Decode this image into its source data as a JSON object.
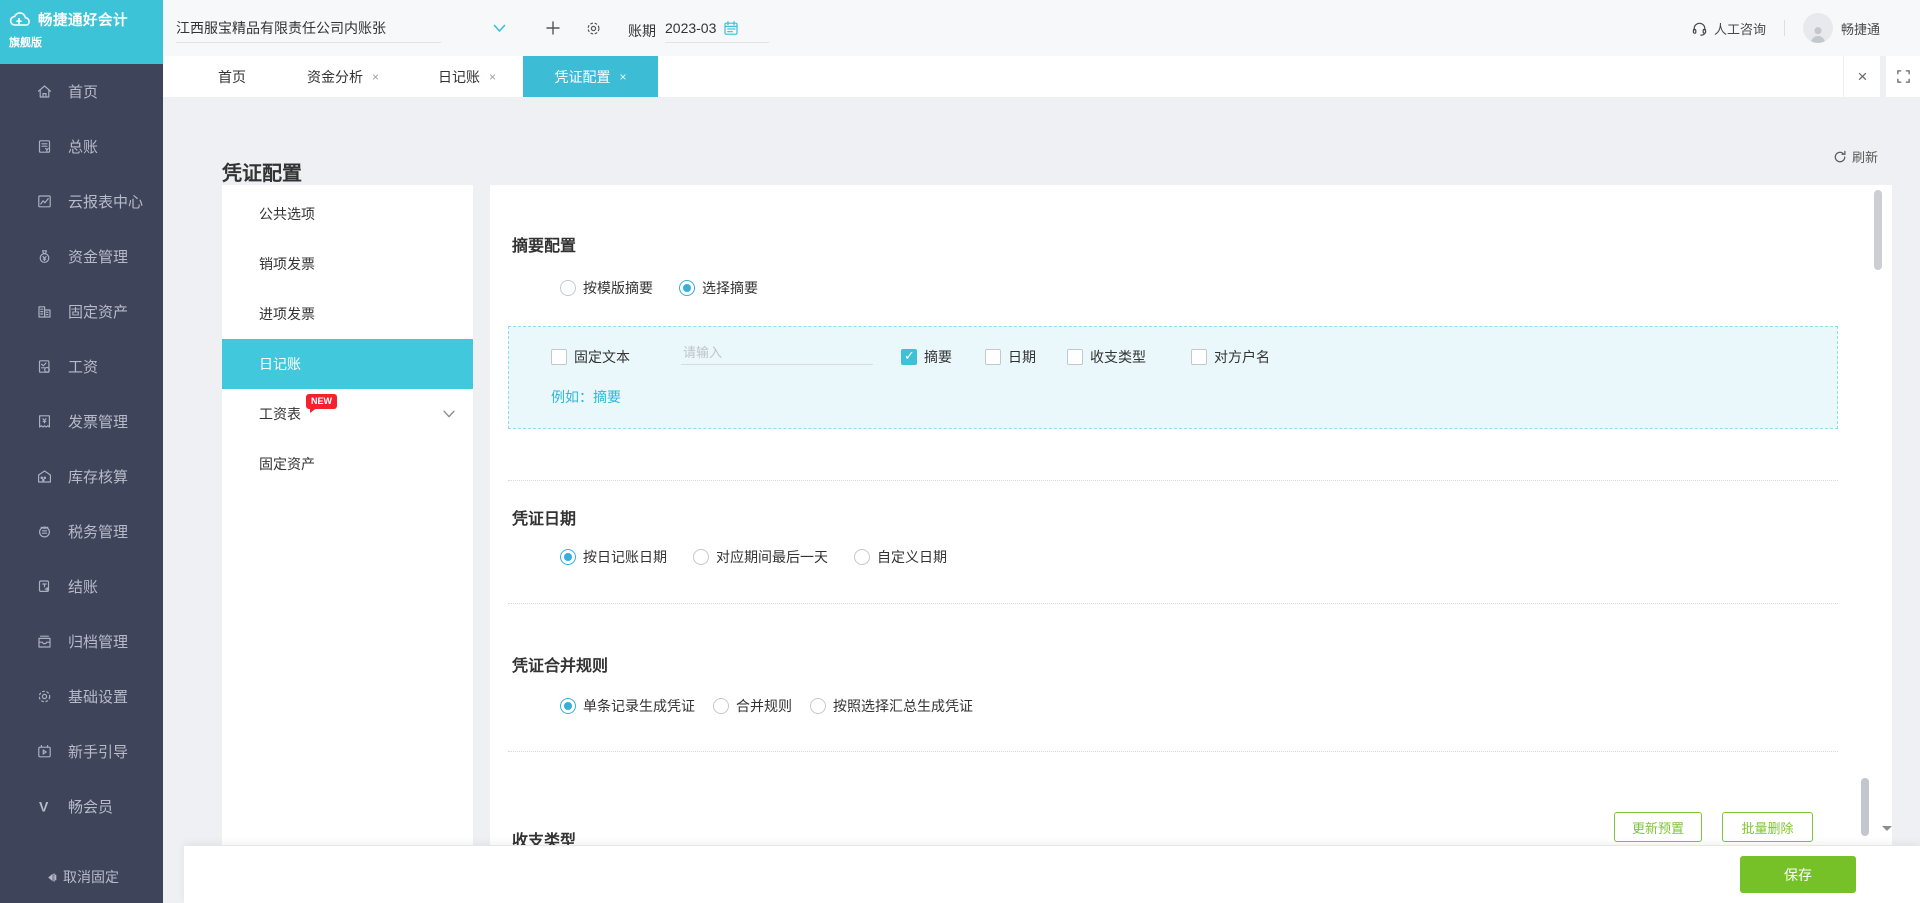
{
  "brand": {
    "logo_title": "畅捷通好会计",
    "logo_subtitle": "旗舰版"
  },
  "topbar": {
    "company": "江西服宝精品有限责任公司内账张",
    "period_label": "账期",
    "period_value": "2023-03",
    "help_label": "人工咨询",
    "username": "畅捷通"
  },
  "tabs": [
    {
      "label": "首页",
      "closable": false,
      "active": false
    },
    {
      "label": "资金分析",
      "closable": true,
      "active": false
    },
    {
      "label": "日记账",
      "closable": true,
      "active": false
    },
    {
      "label": "凭证配置",
      "closable": true,
      "active": true
    }
  ],
  "window_controls": {
    "close": "×"
  },
  "sidebar": {
    "items": [
      {
        "label": "首页",
        "icon": "home-icon"
      },
      {
        "label": "总账",
        "icon": "ledger-icon"
      },
      {
        "label": "云报表中心",
        "icon": "cloud-report-icon"
      },
      {
        "label": "资金管理",
        "icon": "funds-icon"
      },
      {
        "label": "固定资产",
        "icon": "fixed-assets-icon"
      },
      {
        "label": "工资",
        "icon": "salary-icon"
      },
      {
        "label": "发票管理",
        "icon": "invoice-icon"
      },
      {
        "label": "库存核算",
        "icon": "inventory-icon"
      },
      {
        "label": "税务管理",
        "icon": "tax-icon"
      },
      {
        "label": "结账",
        "icon": "closing-icon"
      },
      {
        "label": "归档管理",
        "icon": "archive-icon"
      },
      {
        "label": "基础设置",
        "icon": "settings-icon"
      },
      {
        "label": "新手引导",
        "icon": "guide-icon"
      },
      {
        "label": "畅会员",
        "icon": "member-icon"
      }
    ],
    "unpin_label": "取消固定"
  },
  "page": {
    "title": "凭证配置",
    "refresh_label": "刷新"
  },
  "submenu": {
    "items": [
      {
        "label": "公共选项",
        "selected": false
      },
      {
        "label": "销项发票",
        "selected": false
      },
      {
        "label": "进项发票",
        "selected": false
      },
      {
        "label": "日记账",
        "selected": true
      },
      {
        "label": "工资表",
        "selected": false,
        "badge": "NEW",
        "expandable": true
      },
      {
        "label": "固定资产",
        "selected": false
      }
    ]
  },
  "form": {
    "summary": {
      "title": "摘要配置",
      "options": [
        {
          "label": "按模版摘要",
          "checked": false
        },
        {
          "label": "选择摘要",
          "checked": true
        }
      ],
      "panel": {
        "fixed_text_label": "固定文本",
        "fixed_text_checked": false,
        "input_placeholder": "请输入",
        "input_value": "",
        "fields": [
          {
            "label": "摘要",
            "checked": true
          },
          {
            "label": "日期",
            "checked": false
          },
          {
            "label": "收支类型",
            "checked": false
          },
          {
            "label": "对方户名",
            "checked": false
          }
        ],
        "example_text": "例如：摘要"
      }
    },
    "voucher_date": {
      "title": "凭证日期",
      "options": [
        {
          "label": "按日记账日期",
          "checked": true
        },
        {
          "label": "对应期间最后一天",
          "checked": false
        },
        {
          "label": "自定义日期",
          "checked": false
        }
      ]
    },
    "merge_rule": {
      "title": "凭证合并规则",
      "options": [
        {
          "label": "单条记录生成凭证",
          "checked": true
        },
        {
          "label": "合并规则",
          "checked": false
        },
        {
          "label": "按照选择汇总生成凭证",
          "checked": false
        }
      ]
    },
    "income_type": {
      "title": "收支类型",
      "buttons": [
        {
          "label": "更新预置"
        },
        {
          "label": "批量删除"
        }
      ]
    }
  },
  "footer": {
    "save_label": "保存"
  },
  "colors": {
    "accent": "#3cc0d6",
    "active_tab": "#3dbcd6",
    "sidebar_bg": "#3e4459",
    "selected_submenu": "#41c8dc",
    "panel_bg": "#eaf7fb",
    "green_button": "#76c128",
    "green_outline": "#7fc437",
    "badge_red": "#f5222d",
    "radio_checked": "#38aedc"
  }
}
